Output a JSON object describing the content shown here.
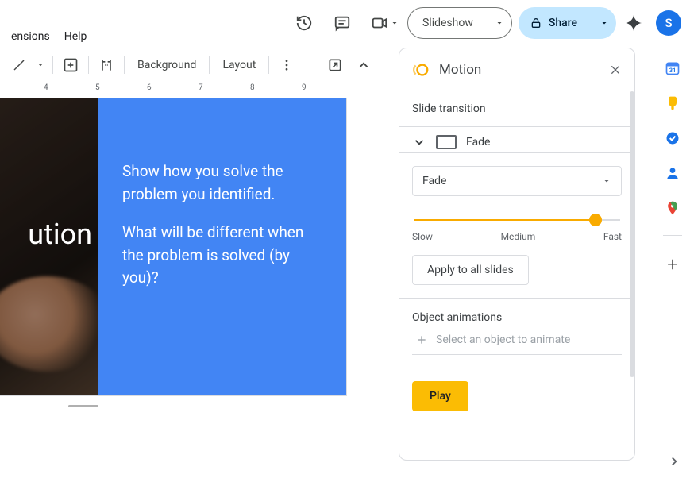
{
  "menu": {
    "extensions": "ensions",
    "help": "Help"
  },
  "topbar": {
    "slideshow": "Slideshow",
    "share": "Share",
    "avatar": "S"
  },
  "toolbar": {
    "background": "Background",
    "layout": "Layout"
  },
  "ruler": {
    "n4": "4",
    "n5": "5",
    "n6": "6",
    "n7": "7",
    "n8": "8",
    "n9": "9"
  },
  "slide": {
    "title_fragment": "ution",
    "para1": "Show how you solve the problem you identified.",
    "para2": "What will be different when the problem is solved (by you)?"
  },
  "motion": {
    "panel_title": "Motion",
    "slide_transition": "Slide transition",
    "transition_name": "Fade",
    "select_value": "Fade",
    "speed": {
      "slow": "Slow",
      "medium": "Medium",
      "fast": "Fast",
      "value_pct": 88
    },
    "apply_all": "Apply to all slides",
    "object_animations": "Object animations",
    "select_object": "Select an object to animate",
    "play": "Play"
  },
  "rail": {
    "calendar_day": "31"
  }
}
